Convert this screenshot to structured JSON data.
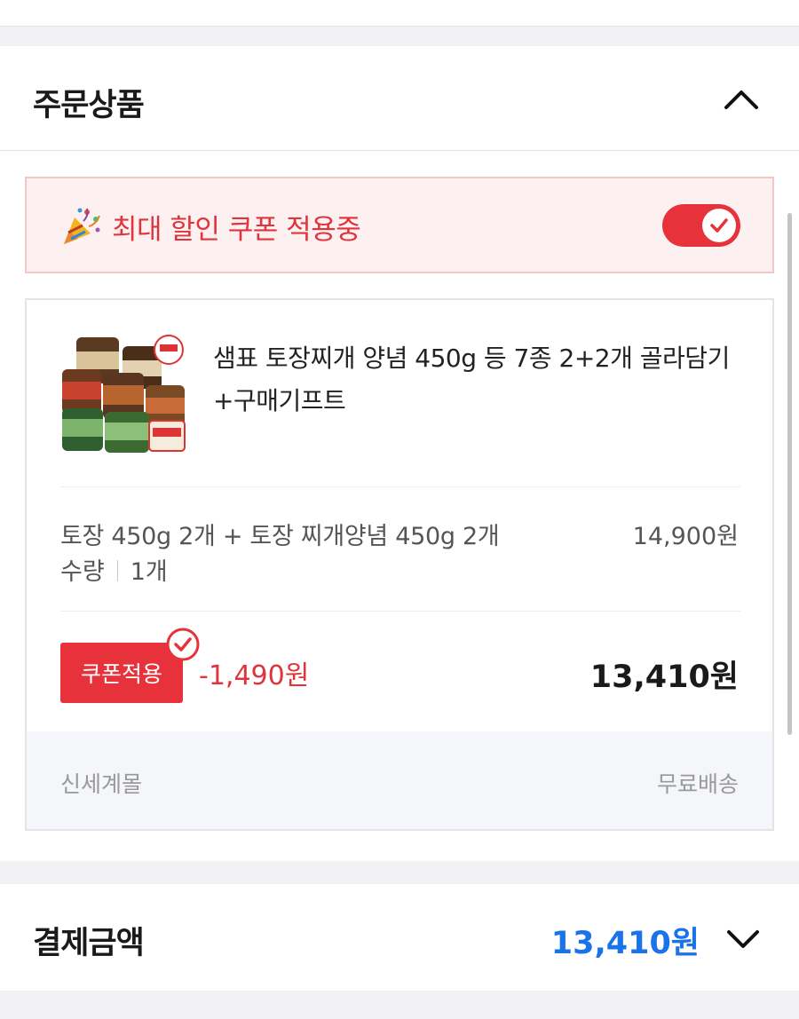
{
  "order_section": {
    "title": "주문상품",
    "collapse_icon": "chevron-up-icon"
  },
  "coupon_banner": {
    "icon": "party-popper-icon",
    "text": "최대 할인 쿠폰 적용중",
    "toggle_on": true,
    "accent_color": "#e8323b"
  },
  "product": {
    "name": "샘표 토장찌개 양념 450g 등 7종 2+2개 골라담기 +구매기프트",
    "option": "토장 450g 2개 + 토장 찌개양념 450g 2개",
    "option_price": "14,900원",
    "qty_label": "수량",
    "qty_value": "1개",
    "coupon_button": "쿠폰적용",
    "discount": "-1,490원",
    "final_price": "13,410원",
    "seller": "신세계몰",
    "shipping": "무료배송"
  },
  "payment": {
    "title": "결제금액",
    "amount": "13,410원",
    "expand_icon": "chevron-down-icon",
    "amount_color": "#1a73e8"
  }
}
